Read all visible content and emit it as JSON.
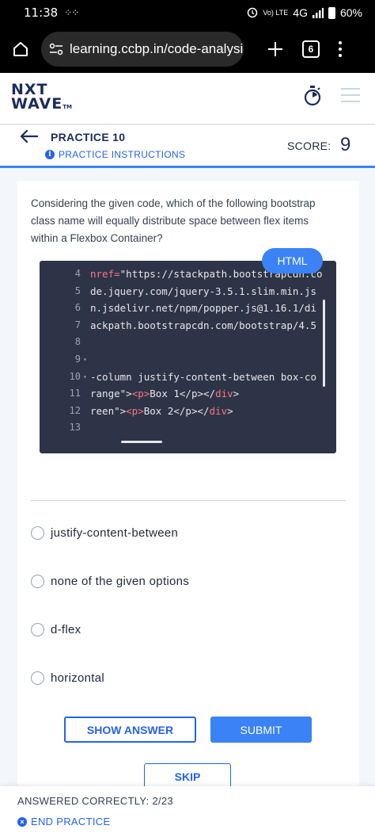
{
  "status_bar": {
    "time": "11:38",
    "network_top": "Vo) LTE",
    "network": "4G",
    "battery": "60%"
  },
  "browser": {
    "url": "learning.ccbp.in/code-analysis",
    "tab_count": "6"
  },
  "app": {
    "logo_line1": "NXT",
    "logo_line2": "WAVE",
    "logo_tm": "TM"
  },
  "practice": {
    "title": "PRACTICE 10",
    "instructions_label": "PRACTICE INSTRUCTIONS",
    "score_label": "SCORE:",
    "score_value": "9"
  },
  "question": {
    "text": "Considering the given code, which of the following bootstrap class name will equally distribute space between flex items within a Flexbox Container?",
    "language_badge": "HTML"
  },
  "code": {
    "lines": [
      {
        "num": "4",
        "fold": "",
        "segments": [
          {
            "t": "nref=",
            "c": "attr"
          },
          {
            "t": "\"https://stackpath.bootstrapcdn.co",
            "c": ""
          }
        ]
      },
      {
        "num": "5",
        "fold": "",
        "segments": [
          {
            "t": "de.jquery.com/jquery-3.5.1.slim.min.js",
            "c": ""
          }
        ]
      },
      {
        "num": "6",
        "fold": "",
        "segments": [
          {
            "t": "n.jsdelivr.net/npm/popper.js@1.16.1/di",
            "c": ""
          }
        ]
      },
      {
        "num": "7",
        "fold": "",
        "segments": [
          {
            "t": "ackpath.bootstrapcdn.com/bootstrap/4.5",
            "c": ""
          }
        ]
      },
      {
        "num": "8",
        "fold": "",
        "segments": []
      },
      {
        "num": "9",
        "fold": "▾",
        "segments": []
      },
      {
        "num": "10",
        "fold": "▾",
        "segments": [
          {
            "t": "-column justify-content-between box-co",
            "c": ""
          }
        ]
      },
      {
        "num": "11",
        "fold": "",
        "segments": [
          {
            "t": "range\">",
            "c": ""
          },
          {
            "t": "<p>",
            "c": "tag"
          },
          {
            "t": "Box 1",
            "c": ""
          },
          {
            "t": "</p></",
            "c": ""
          },
          {
            "t": "div",
            "c": "tag"
          },
          {
            "t": ">",
            "c": ""
          }
        ]
      },
      {
        "num": "12",
        "fold": "",
        "segments": [
          {
            "t": "reen\">",
            "c": ""
          },
          {
            "t": "<p>",
            "c": "tag"
          },
          {
            "t": "Box 2",
            "c": ""
          },
          {
            "t": "</p></",
            "c": ""
          },
          {
            "t": "div",
            "c": "tag"
          },
          {
            "t": ">",
            "c": ""
          }
        ]
      },
      {
        "num": "13",
        "fold": "",
        "segments": []
      }
    ]
  },
  "options": [
    {
      "label": "justify-content-between"
    },
    {
      "label": "none of the given options"
    },
    {
      "label": "d-flex"
    },
    {
      "label": "horizontal"
    }
  ],
  "buttons": {
    "show_answer": "SHOW ANSWER",
    "submit": "SUBMIT",
    "skip": "SKIP"
  },
  "footer": {
    "answered": "ANSWERED CORRECTLY: 2/23",
    "end_practice": "END PRACTICE"
  },
  "colors": {
    "primary": "#3b82f6",
    "navy": "#1b2c5c",
    "code_bg": "#2e3447"
  }
}
